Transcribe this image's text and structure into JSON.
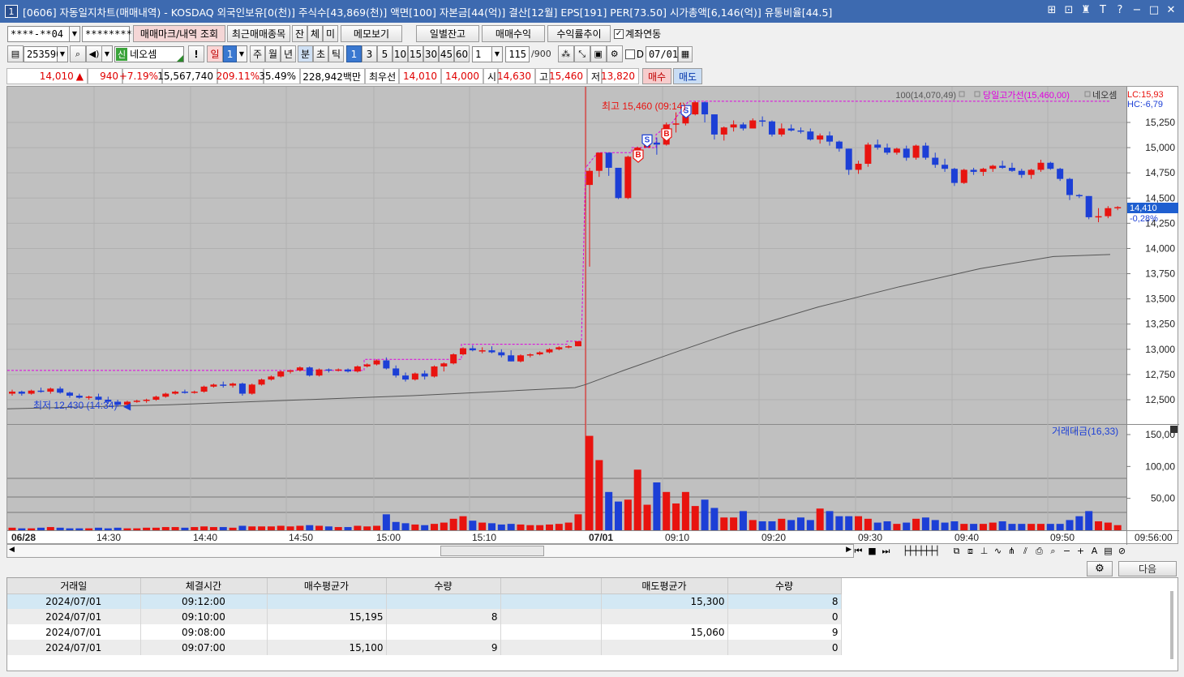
{
  "window": {
    "number": "1",
    "title": "[0606] 자동일지차트(매매내역) - KOSDAQ 외국인보유[0(천)] 주식수[43,869(천)] 액면[100] 자본금[44(억)] 결산[12월] EPS[191] PER[73.50] 시가총액[6,146(억)] 유통비율[44.5]",
    "icons": [
      "⊞",
      "⊡",
      "♜",
      "T",
      "?",
      "−",
      "□",
      "✕"
    ]
  },
  "toolbar1": {
    "account": "****-**04",
    "password": "*********",
    "btn_trade_mark": "매매마크/내역 조회",
    "btn_recent": "최근매매종목",
    "btn_jan": "잔",
    "btn_che": "체",
    "btn_mi": "미",
    "btn_memo": "메모보기",
    "btn_daily_balance": "일별잔고",
    "btn_trade_profit": "매매수익",
    "btn_profit_rate": "수익률추이",
    "chk_link_label": "계좌연동"
  },
  "toolbar2": {
    "code": "253590",
    "badge": "신",
    "name": "네오셈",
    "btn_excl": "!",
    "period_il": "일",
    "period_num": "1",
    "btn_ju": "주",
    "btn_wol": "월",
    "btn_nyeon": "년",
    "btn_bun": "분",
    "btn_cho": "초",
    "btn_tik": "틱",
    "min_options": [
      "1",
      "3",
      "5",
      "10",
      "15",
      "30",
      "45",
      "60"
    ],
    "interval_value": "1",
    "count_value": "115",
    "count_total": "/900",
    "date_label": "D",
    "date_value": "07/01"
  },
  "quote": {
    "price": "14,010",
    "arrow": "▲",
    "change": "940",
    "change_pct": "+7.19%",
    "volume": "15,567,740",
    "vol_ratio": "209.11%",
    "turnover": "35.49%",
    "amount": "228,942백만",
    "best_ask_label": "최우선",
    "ask": "14,010",
    "bid": "14,000",
    "open_label": "시",
    "open": "14,630",
    "high_label": "고",
    "high": "15,460",
    "low_label": "저",
    "low": "13,820",
    "btn_buy": "매수",
    "btn_sell": "매도"
  },
  "chart_data": {
    "type": "candlestick",
    "price_axis": [
      "15,250",
      "15,000",
      "14,750",
      "14,500",
      "14,250",
      "14,000",
      "13,750",
      "13,500",
      "13,250",
      "13,000",
      "12,750",
      "12,500"
    ],
    "volume_axis": [
      "150,00",
      "100,00",
      "50,00"
    ],
    "time_axis": [
      "06/28",
      "14:30",
      "14:40",
      "14:50",
      "15:00",
      "15:10",
      "07/01",
      "09:10",
      "09:20",
      "09:30",
      "09:40",
      "09:50",
      "09:56:00"
    ],
    "legend_ma": "100(14,070,49)",
    "legend_high_line": "당일고가선(15,460,00)",
    "legend_name": "네오셈",
    "lc_label": "LC:15,93",
    "hc_label": "HC:-6,79",
    "current_price_tag": "14,410",
    "current_pct": "-0,28%",
    "high_annotation": "최고 15,460 (09:14)",
    "low_annotation": "최저 12,430 (14:34)",
    "volume_legend": "거래대금(16,33)",
    "trade_marks": [
      "B",
      "S",
      "B",
      "S"
    ],
    "candles_0628": [
      [
        12560,
        12600,
        12540,
        12580
      ],
      [
        12580,
        12590,
        12540,
        12560
      ],
      [
        12560,
        12600,
        12550,
        12590
      ],
      [
        12590,
        12620,
        12570,
        12580
      ],
      [
        12580,
        12620,
        12560,
        12610
      ],
      [
        12610,
        12630,
        12560,
        12570
      ],
      [
        12570,
        12580,
        12520,
        12540
      ],
      [
        12540,
        12560,
        12510,
        12520
      ],
      [
        12520,
        12540,
        12500,
        12530
      ],
      [
        12530,
        12560,
        12490,
        12500
      ],
      [
        12500,
        12530,
        12460,
        12480
      ],
      [
        12480,
        12500,
        12430,
        12450
      ],
      [
        12450,
        12490,
        12440,
        12480
      ],
      [
        12480,
        12500,
        12470,
        12490
      ],
      [
        12490,
        12510,
        12470,
        12500
      ],
      [
        12500,
        12540,
        12490,
        12530
      ],
      [
        12530,
        12570,
        12520,
        12560
      ],
      [
        12560,
        12590,
        12550,
        12580
      ],
      [
        12580,
        12600,
        12560,
        12570
      ],
      [
        12570,
        12590,
        12560,
        12580
      ],
      [
        12580,
        12640,
        12570,
        12630
      ],
      [
        12630,
        12660,
        12620,
        12650
      ],
      [
        12650,
        12680,
        12620,
        12640
      ],
      [
        12640,
        12670,
        12620,
        12660
      ],
      [
        12660,
        12670,
        12540,
        12560
      ],
      [
        12560,
        12660,
        12550,
        12650
      ],
      [
        12650,
        12710,
        12640,
        12700
      ],
      [
        12700,
        12740,
        12690,
        12730
      ],
      [
        12730,
        12790,
        12720,
        12780
      ],
      [
        12780,
        12800,
        12760,
        12790
      ],
      [
        12790,
        12830,
        12780,
        12820
      ],
      [
        12820,
        12830,
        12730,
        12740
      ],
      [
        12740,
        12810,
        12730,
        12800
      ],
      [
        12800,
        12810,
        12770,
        12790
      ],
      [
        12790,
        12810,
        12780,
        12800
      ],
      [
        12800,
        12810,
        12770,
        12780
      ],
      [
        12780,
        12840,
        12770,
        12830
      ],
      [
        12830,
        12860,
        12820,
        12850
      ],
      [
        12850,
        12900,
        12840,
        12890
      ],
      [
        12890,
        12920,
        12800,
        12810
      ],
      [
        12810,
        12840,
        12720,
        12740
      ],
      [
        12740,
        12770,
        12680,
        12700
      ],
      [
        12700,
        12770,
        12690,
        12760
      ],
      [
        12760,
        12790,
        12700,
        12730
      ],
      [
        12730,
        12840,
        12720,
        12830
      ],
      [
        12830,
        12870,
        12780,
        12860
      ],
      [
        12860,
        12960,
        12850,
        12950
      ],
      [
        12950,
        13020,
        12940,
        13010
      ],
      [
        13010,
        13040,
        12980,
        12990
      ],
      [
        12990,
        13020,
        12960,
        12990
      ],
      [
        12990,
        13030,
        12960,
        12970
      ],
      [
        12970,
        13000,
        12920,
        12940
      ],
      [
        12940,
        12990,
        12880,
        12880
      ],
      [
        12880,
        12950,
        12870,
        12940
      ],
      [
        12940,
        12960,
        12920,
        12950
      ],
      [
        12950,
        12980,
        12940,
        12970
      ],
      [
        12970,
        13010,
        12960,
        13000
      ],
      [
        13000,
        13030,
        12990,
        13020
      ],
      [
        13020,
        13040,
        13010,
        13030
      ],
      [
        13030,
        13080,
        13030,
        13080
      ]
    ],
    "candles_0701": [
      [
        14630,
        14800,
        13820,
        14770
      ],
      [
        14770,
        14950,
        14710,
        14950
      ],
      [
        14950,
        14950,
        14720,
        14800
      ],
      [
        14800,
        14800,
        14490,
        14500
      ],
      [
        14500,
        14920,
        14490,
        14910
      ],
      [
        14910,
        15010,
        14900,
        15000
      ],
      [
        15000,
        15100,
        15040,
        15050
      ],
      [
        15050,
        15100,
        14930,
        15030
      ],
      [
        15030,
        15250,
        15020,
        15230
      ],
      [
        15230,
        15350,
        15150,
        15240
      ],
      [
        15240,
        15350,
        15220,
        15330
      ],
      [
        15330,
        15460,
        15320,
        15450
      ],
      [
        15450,
        15460,
        15250,
        15330
      ],
      [
        15330,
        15330,
        15080,
        15130
      ],
      [
        15130,
        15210,
        15070,
        15200
      ],
      [
        15200,
        15270,
        15160,
        15230
      ],
      [
        15230,
        15250,
        15170,
        15190
      ],
      [
        15190,
        15290,
        15190,
        15270
      ],
      [
        15270,
        15310,
        15210,
        15260
      ],
      [
        15260,
        15270,
        15110,
        15130
      ],
      [
        15130,
        15240,
        15110,
        15190
      ],
      [
        15190,
        15230,
        15160,
        15170
      ],
      [
        15170,
        15200,
        15140,
        15160
      ],
      [
        15160,
        15190,
        15070,
        15080
      ],
      [
        15080,
        15140,
        15040,
        15120
      ],
      [
        15120,
        15160,
        15020,
        15060
      ],
      [
        15060,
        15070,
        14960,
        14990
      ],
      [
        14990,
        14990,
        14730,
        14780
      ],
      [
        14780,
        14870,
        14740,
        14840
      ],
      [
        14840,
        15050,
        14810,
        15030
      ],
      [
        15030,
        15080,
        14980,
        15000
      ],
      [
        15000,
        15040,
        14930,
        14950
      ],
      [
        14950,
        15000,
        14930,
        14990
      ],
      [
        14990,
        15020,
        14870,
        14900
      ],
      [
        14900,
        15030,
        14880,
        15020
      ],
      [
        15020,
        15050,
        14880,
        14900
      ],
      [
        14900,
        14950,
        14800,
        14830
      ],
      [
        14830,
        14890,
        14760,
        14790
      ],
      [
        14790,
        14800,
        14620,
        14650
      ],
      [
        14650,
        14790,
        14640,
        14780
      ],
      [
        14780,
        14800,
        14730,
        14760
      ],
      [
        14760,
        14800,
        14720,
        14790
      ],
      [
        14790,
        14830,
        14760,
        14820
      ],
      [
        14820,
        14870,
        14790,
        14800
      ],
      [
        14800,
        14850,
        14760,
        14770
      ],
      [
        14770,
        14790,
        14700,
        14730
      ],
      [
        14730,
        14790,
        14690,
        14780
      ],
      [
        14780,
        14880,
        14760,
        14850
      ],
      [
        14850,
        14860,
        14780,
        14790
      ],
      [
        14790,
        14800,
        14670,
        14690
      ],
      [
        14690,
        14700,
        14480,
        14530
      ],
      [
        14530,
        14540,
        14500,
        14520
      ],
      [
        14520,
        14520,
        14290,
        14310
      ],
      [
        14310,
        14400,
        14260,
        14320
      ],
      [
        14320,
        14420,
        14300,
        14400
      ],
      [
        14410,
        14420,
        14380,
        14410
      ]
    ],
    "vol_0628": [
      4,
      3,
      3,
      4,
      5,
      4,
      3,
      3,
      3,
      4,
      3,
      4,
      3,
      3,
      4,
      4,
      5,
      5,
      4,
      5,
      6,
      5,
      5,
      4,
      7,
      6,
      6,
      6,
      7,
      6,
      7,
      8,
      7,
      6,
      5,
      5,
      7,
      6,
      7,
      25,
      13,
      11,
      9,
      8,
      10,
      12,
      18,
      22,
      15,
      12,
      11,
      9,
      10,
      9,
      8,
      8,
      9,
      10,
      12,
      25
    ],
    "vol_0701": [
      148,
      110,
      60,
      45,
      48,
      95,
      40,
      75,
      60,
      42,
      60,
      38,
      48,
      35,
      20,
      20,
      30,
      16,
      14,
      14,
      18,
      16,
      20,
      16,
      34,
      30,
      22,
      22,
      22,
      18,
      12,
      14,
      10,
      12,
      18,
      20,
      16,
      12,
      14,
      10,
      10,
      10,
      12,
      14,
      10,
      10,
      10,
      10,
      10,
      10,
      16,
      22,
      30,
      14,
      12,
      8
    ]
  },
  "bottom": {
    "btn_next": "다음",
    "headers": [
      "거래일",
      "체결시간",
      "매수평균가",
      "수량",
      "",
      "매도평균가",
      "수량"
    ],
    "rows": [
      [
        "2024/07/01",
        "09:12:00",
        "",
        "",
        "",
        "15,300",
        "8"
      ],
      [
        "2024/07/01",
        "09:10:00",
        "15,195",
        "8",
        "",
        "",
        "0"
      ],
      [
        "2024/07/01",
        "09:08:00",
        "",
        "",
        "",
        "15,060",
        "9"
      ],
      [
        "2024/07/01",
        "09:07:00",
        "15,100",
        "9",
        "",
        "",
        "0"
      ]
    ]
  },
  "colors": {
    "up": "#e8130f",
    "down": "#1c3fd6",
    "title_bg": "#3d6ab0",
    "high_line": "#e000e0",
    "ma": "#555555"
  }
}
